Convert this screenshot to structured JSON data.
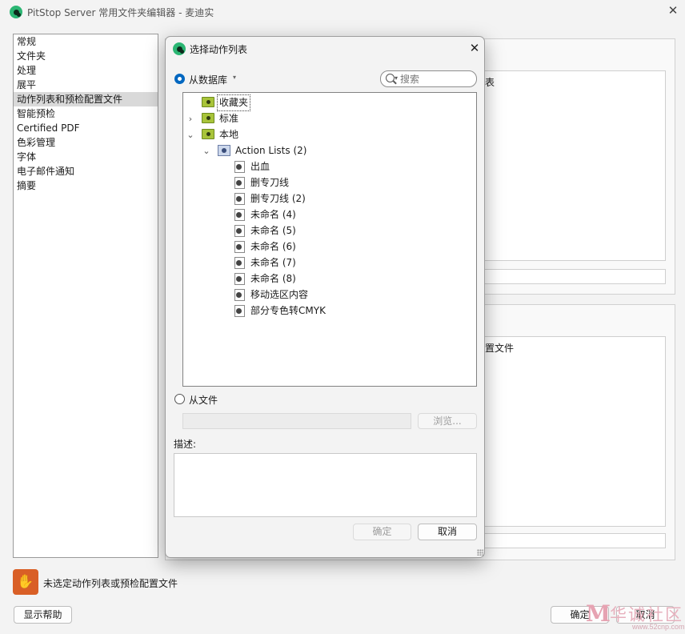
{
  "app": {
    "title": "PitStop Server 常用文件夹编辑器 - 麦迪实",
    "close_glyph": "✕"
  },
  "nav": {
    "items": [
      {
        "label": "常规"
      },
      {
        "label": "文件夹"
      },
      {
        "label": "处理"
      },
      {
        "label": "展平"
      },
      {
        "label": "动作列表和预检配置文件",
        "selected": true
      },
      {
        "label": "智能预检"
      },
      {
        "label": "Certified PDF"
      },
      {
        "label": "色彩管理"
      },
      {
        "label": "字体"
      },
      {
        "label": "电子邮件通知"
      },
      {
        "label": "摘要"
      }
    ]
  },
  "background": {
    "peek_top": "表",
    "peek_bottom": "置文件"
  },
  "status": {
    "message": "未选定动作列表或预检配置文件",
    "icon": "hand-icon"
  },
  "buttons": {
    "help": "显示帮助",
    "ok": "确定",
    "cancel": "取消"
  },
  "watermark": {
    "text": "华诚社区",
    "url": "www.52cnp.com"
  },
  "dialog": {
    "title": "选择动作列表",
    "close_glyph": "✕",
    "source_db": "从数据库",
    "source_file": "从文件",
    "search_placeholder": "搜索",
    "browse": "浏览...",
    "desc_label": "描述:",
    "ok": "确定",
    "cancel": "取消",
    "tree": {
      "favorites": "收藏夹",
      "standard": "标准",
      "local": "本地",
      "action_lists": "Action Lists (2)",
      "items": [
        "出血",
        "删专刀线",
        "删专刀线 (2)",
        "未命名 (4)",
        "未命名 (5)",
        "未命名 (6)",
        "未命名 (7)",
        "未命名 (8)",
        "移动选区内容",
        "部分专色转CMYK"
      ]
    }
  }
}
